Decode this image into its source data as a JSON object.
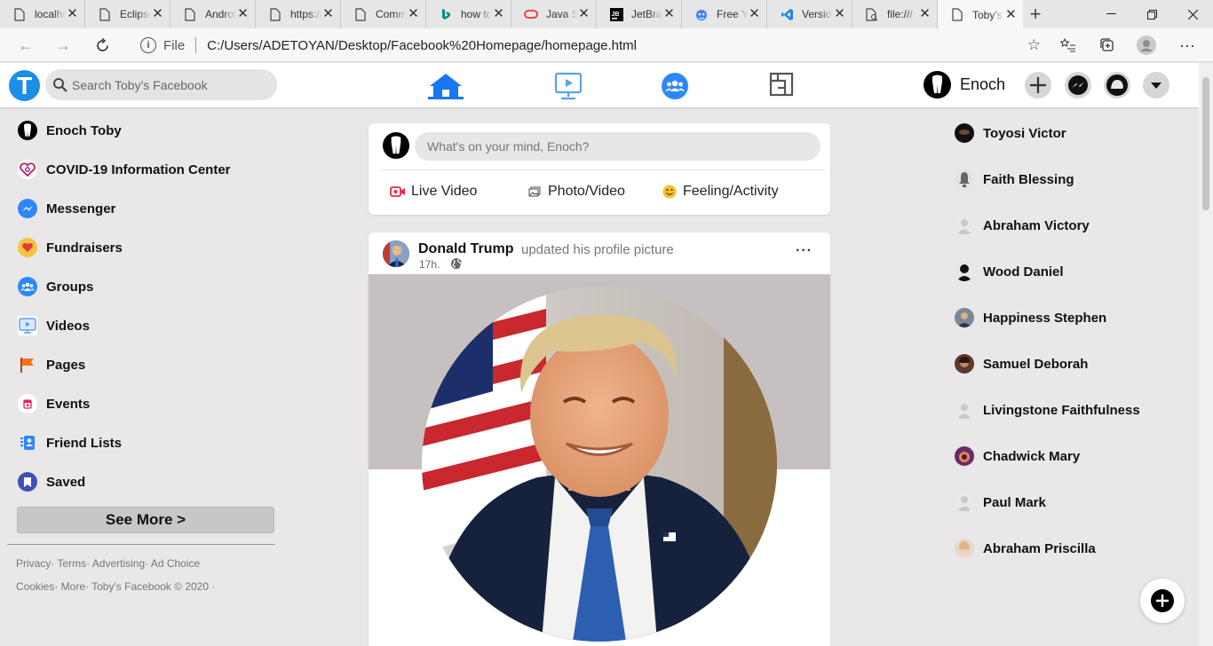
{
  "browser": {
    "tabs": [
      {
        "label": "localhost",
        "icon": "page-icon"
      },
      {
        "label": "Eclipse",
        "icon": "page-icon"
      },
      {
        "label": "Android",
        "icon": "page-icon"
      },
      {
        "label": "https://",
        "icon": "page-icon"
      },
      {
        "label": "Comm",
        "icon": "page-icon"
      },
      {
        "label": "how to",
        "icon": "bing-icon"
      },
      {
        "label": "Java S",
        "icon": "oracle-icon"
      },
      {
        "label": "JetBra",
        "icon": "jetbrains-icon"
      },
      {
        "label": "Free Y",
        "icon": "robot-icon"
      },
      {
        "label": "Versio",
        "icon": "vscode-icon"
      },
      {
        "label": "file:///",
        "icon": "file-icon"
      },
      {
        "label": "Toby's",
        "icon": "page-icon",
        "active": true
      }
    ],
    "address": {
      "scheme_label": "File",
      "url": "C:/Users/ADETOYAN/Desktop/Facebook%20Homepage/homepage.html"
    }
  },
  "header": {
    "logo_letter": "T",
    "search_placeholder": "Search Toby's Facebook",
    "profile_name": "Enoch"
  },
  "left_menu": [
    {
      "label": "Enoch Toby",
      "icon": "profile-avatar-icon"
    },
    {
      "label": "COVID-19 Information Center",
      "icon": "covid-heart-icon"
    },
    {
      "label": "Messenger",
      "icon": "messenger-icon"
    },
    {
      "label": "Fundraisers",
      "icon": "fundraiser-heart-icon"
    },
    {
      "label": "Groups",
      "icon": "groups-icon"
    },
    {
      "label": "Videos",
      "icon": "video-icon"
    },
    {
      "label": "Pages",
      "icon": "flag-icon"
    },
    {
      "label": "Events",
      "icon": "calendar-icon"
    },
    {
      "label": "Friend Lists",
      "icon": "friend-list-icon"
    },
    {
      "label": "Saved",
      "icon": "bookmark-icon"
    }
  ],
  "see_more": "See More >",
  "footer": {
    "line1": "Privacy· Terms· Advertising· Ad Choice",
    "line2": "Cookies· More· Toby's Facebook © 2020 ·"
  },
  "composer": {
    "placeholder": "What's on your mind, Enoch?",
    "actions": [
      {
        "label": "Live Video",
        "icon": "live-video-icon"
      },
      {
        "label": "Photo/Video",
        "icon": "photo-icon"
      },
      {
        "label": "Feeling/Activity",
        "icon": "smiley-icon"
      }
    ]
  },
  "post": {
    "author": "Donald Trump",
    "action": "updated his profile picture",
    "time": "17h.",
    "more": "···"
  },
  "contacts": [
    {
      "name": "Toyosi Victor"
    },
    {
      "name": "Faith Blessing"
    },
    {
      "name": "Abraham Victory"
    },
    {
      "name": "Wood Daniel"
    },
    {
      "name": "Happiness Stephen"
    },
    {
      "name": "Samuel Deborah"
    },
    {
      "name": "Livingstone Faithfulness"
    },
    {
      "name": "Chadwick Mary"
    },
    {
      "name": "Paul Mark"
    },
    {
      "name": "Abraham Priscilla"
    }
  ],
  "colors": {
    "brand_blue": "#1877f2",
    "page_bg": "#e9e7e8"
  }
}
